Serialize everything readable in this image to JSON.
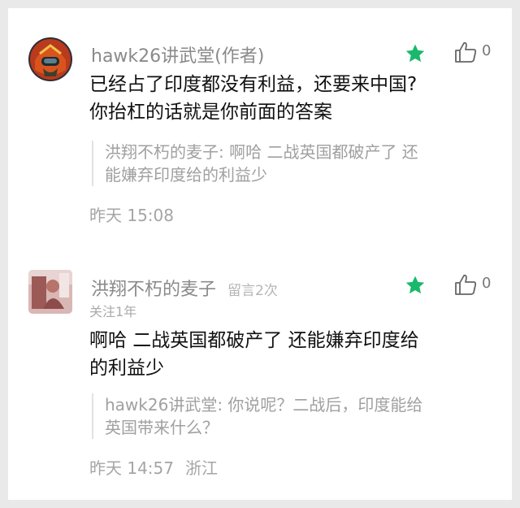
{
  "comments": [
    {
      "author": "hawk26讲武堂(作者)",
      "like_count": "0",
      "text_lines": [
        "已经占了印度都没有利益，还要来中国?",
        "你抬杠的话就是你前面的答案"
      ],
      "quote_lines": [
        "洪翔不朽的麦子: 啊哈 二战英国都破产了 还",
        "能嫌弃印度给的利益少"
      ],
      "time": "昨天 15:08",
      "icons": {
        "avatar": "pilot-helmet-avatar",
        "star": "star-icon",
        "like": "thumbs-up-icon"
      }
    },
    {
      "author": "洪翔不朽的麦子",
      "message_count": "留言2次",
      "follow": "关注1年",
      "like_count": "0",
      "text_lines": [
        "啊哈 二战英国都破产了 还能嫌弃印度给",
        "的利益少"
      ],
      "quote_lines": [
        "hawk26讲武堂: 你说呢？二战后，印度能给",
        "英国带来什么？"
      ],
      "time": "昨天 14:57",
      "location": "浙江",
      "icons": {
        "avatar": "photo-avatar",
        "star": "star-icon",
        "like": "thumbs-up-icon"
      }
    }
  ],
  "colors": {
    "star": "#19b96b",
    "text": "#111111",
    "meta": "#a5a5a5",
    "background": "#e9e9e9"
  }
}
